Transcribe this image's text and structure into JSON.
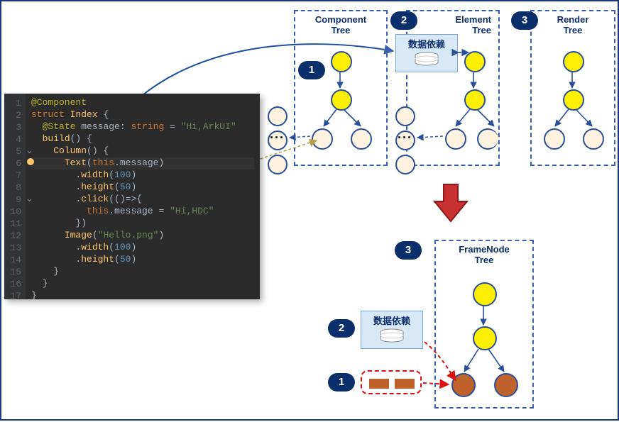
{
  "code": {
    "lines": [
      {
        "n": "1",
        "html": "<span class='tok-ann'>@Component</span>"
      },
      {
        "n": "2",
        "html": "<span class='tok-kw'>struct</span> <span class='tok-type'>Index</span> {"
      },
      {
        "n": "3",
        "html": "  <span class='tok-ann'>@State</span> <span class='tok-id'>message</span>: <span class='tok-kw'>string</span> = <span class='tok-str'>\"Hi,ArkUI\"</span>"
      },
      {
        "n": "4",
        "html": "  <span class='tok-fn'>build</span>() {"
      },
      {
        "n": "5",
        "html": "    <span class='tok-fn'>Column</span>() {",
        "fold": true
      },
      {
        "n": "6",
        "html": "      <span class='tok-fn'>Text</span>(<span class='tok-kw'>this</span>.<span class='tok-id'>message</span>)",
        "hl": true,
        "bulb": true
      },
      {
        "n": "7",
        "html": "        .<span class='tok-fn'>width</span>(<span class='tok-num'>100</span>)"
      },
      {
        "n": "8",
        "html": "        .<span class='tok-fn'>height</span>(<span class='tok-num'>50</span>)"
      },
      {
        "n": "9",
        "html": "        .<span class='tok-fn'>click</span>(()=>{",
        "fold": true
      },
      {
        "n": "10",
        "html": "          <span class='tok-kw'>this</span>.<span class='tok-id'>message</span> = <span class='tok-str'>\"Hi,HDC\"</span>"
      },
      {
        "n": "11",
        "html": "        })"
      },
      {
        "n": "12",
        "html": "      <span class='tok-fn'>Image</span>(<span class='tok-str'>\"Hello.png\"</span>)"
      },
      {
        "n": "13",
        "html": "        .<span class='tok-fn'>width</span>(<span class='tok-num'>100</span>)"
      },
      {
        "n": "14",
        "html": "        .<span class='tok-fn'>height</span>(<span class='tok-num'>50</span>)"
      },
      {
        "n": "15",
        "html": "    }"
      },
      {
        "n": "16",
        "html": "  }"
      },
      {
        "n": "17",
        "html": "}"
      }
    ]
  },
  "badges_top": {
    "one": "1",
    "two": "2",
    "three": "3"
  },
  "badges_bottom": {
    "one": "1",
    "two": "2",
    "three": "3"
  },
  "trees": {
    "component": {
      "title_l1": "Component",
      "title_l2": "Tree"
    },
    "element": {
      "title_l1": "Element",
      "title_l2": "Tree"
    },
    "render": {
      "title_l1": "Render",
      "title_l2": "Tree"
    },
    "framenode": {
      "title_l1": "FrameNode",
      "title_l2": "Tree"
    }
  },
  "data_dep_label": "数据依赖"
}
